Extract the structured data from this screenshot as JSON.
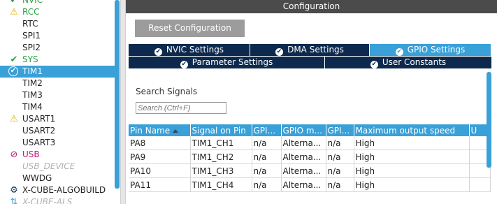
{
  "tree": {
    "items": [
      {
        "label": "NVIC",
        "icon": "check-icon",
        "style": "green"
      },
      {
        "label": "RCC",
        "icon": "warning-icon",
        "style": "green"
      },
      {
        "label": "RTC",
        "icon": "",
        "style": "normal"
      },
      {
        "label": "SPI1",
        "icon": "",
        "style": "normal"
      },
      {
        "label": "SPI2",
        "icon": "",
        "style": "normal"
      },
      {
        "label": "SYS",
        "icon": "check-icon",
        "style": "green"
      },
      {
        "label": "TIM1",
        "icon": "check-circle-icon",
        "style": "selected"
      },
      {
        "label": "TIM2",
        "icon": "",
        "style": "normal"
      },
      {
        "label": "TIM3",
        "icon": "",
        "style": "normal"
      },
      {
        "label": "TIM4",
        "icon": "",
        "style": "normal"
      },
      {
        "label": "USART1",
        "icon": "warning-icon",
        "style": "normal"
      },
      {
        "label": "USART2",
        "icon": "",
        "style": "normal"
      },
      {
        "label": "USART3",
        "icon": "",
        "style": "normal"
      },
      {
        "label": "USB",
        "icon": "ban-icon",
        "style": "magenta"
      },
      {
        "label": "USB_DEVICE",
        "icon": "",
        "style": "disabled"
      },
      {
        "label": "WWDG",
        "icon": "",
        "style": "normal"
      },
      {
        "label": "X-CUBE-ALGOBUILD",
        "icon": "gear-icon",
        "style": "normal"
      },
      {
        "label": "X-CUBE-ALS",
        "icon": "link-icon",
        "style": "disabled"
      }
    ]
  },
  "config": {
    "header": "Configuration",
    "reset_label": "Reset Configuration",
    "tabs_row1": [
      {
        "label": "NVIC Settings",
        "active": false
      },
      {
        "label": "DMA Settings",
        "active": false
      },
      {
        "label": "GPIO Settings",
        "active": true
      }
    ],
    "tabs_row2": [
      {
        "label": "Parameter Settings",
        "active": false
      },
      {
        "label": "User Constants",
        "active": false
      }
    ],
    "search": {
      "label": "Search Signals",
      "placeholder": "Search (Ctrl+F)"
    },
    "table": {
      "columns": [
        "Pin Name",
        "Signal on Pin",
        "GPI...",
        "GPIO m...",
        "GPI...",
        "Maximum output speed",
        "U"
      ],
      "rows": [
        [
          "PA8",
          "TIM1_CH1",
          "n/a",
          "Alterna...",
          "n/a",
          "High",
          ""
        ],
        [
          "PA9",
          "TIM1_CH2",
          "n/a",
          "Alterna...",
          "n/a",
          "High",
          ""
        ],
        [
          "PA10",
          "TIM1_CH3",
          "n/a",
          "Alterna...",
          "n/a",
          "High",
          ""
        ],
        [
          "PA11",
          "TIM1_CH4",
          "n/a",
          "Alterna...",
          "n/a",
          "High",
          ""
        ]
      ]
    }
  },
  "colors": {
    "accent": "#39a0d8",
    "tab_dark": "#0d2a4e",
    "header_bg": "#4b4b4b",
    "ok_green": "#2e9e44",
    "warning": "#e0b000",
    "error_magenta": "#c0187a"
  }
}
